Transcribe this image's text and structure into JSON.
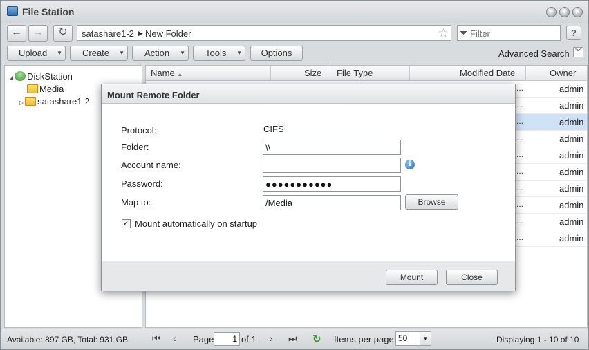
{
  "window": {
    "title": "File Station"
  },
  "nav": {
    "back_icon": "back-arrow-icon",
    "forward_icon": "forward-arrow-icon",
    "refresh_icon": "refresh-icon",
    "path": [
      "satashare1-2",
      "New Folder"
    ],
    "path_separator": "▶",
    "filter_placeholder": "Filter",
    "help_label": "?"
  },
  "toolbar": {
    "buttons": [
      "Upload",
      "Create",
      "Action",
      "Tools"
    ],
    "options_label": "Options",
    "advanced_search": "Advanced Search"
  },
  "tree": {
    "root": "DiskStation",
    "items": [
      "Media",
      "satashare1-2"
    ]
  },
  "grid": {
    "columns": [
      "Name",
      "Size",
      "File Type",
      "Modified Date",
      "Owner"
    ],
    "rows": [
      {
        "owner": "admin",
        "ellipsis": "..."
      },
      {
        "owner": "admin",
        "ellipsis": "..."
      },
      {
        "owner": "admin",
        "ellipsis": "..."
      },
      {
        "owner": "admin",
        "ellipsis": "..."
      },
      {
        "owner": "admin",
        "ellipsis": "..."
      },
      {
        "owner": "admin",
        "ellipsis": "..."
      },
      {
        "owner": "admin",
        "ellipsis": "..."
      },
      {
        "owner": "admin",
        "ellipsis": "..."
      },
      {
        "owner": "admin",
        "ellipsis": "..."
      },
      {
        "owner": "admin",
        "ellipsis": "..."
      }
    ],
    "selected_row_index": 2
  },
  "status": {
    "available": "Available: 897 GB, Total: 931 GB",
    "page_label": "Page",
    "page_value": "1",
    "of_label": "of 1",
    "items_per_page_label": "Items per page",
    "items_per_page_value": "50",
    "displaying": "Displaying 1 - 10 of 10"
  },
  "dialog": {
    "title": "Mount Remote Folder",
    "protocol_label": "Protocol:",
    "protocol_value": "CIFS",
    "folder_label": "Folder:",
    "folder_value": "\\\\",
    "account_label": "Account name:",
    "account_value": "",
    "password_label": "Password:",
    "password_value": "●●●●●●●●●●●",
    "mapto_label": "Map to:",
    "mapto_value": "/Media",
    "browse_label": "Browse",
    "auto_mount_label": "Mount automatically on startup",
    "auto_mount_checked": true,
    "mount_label": "Mount",
    "close_label": "Close"
  }
}
